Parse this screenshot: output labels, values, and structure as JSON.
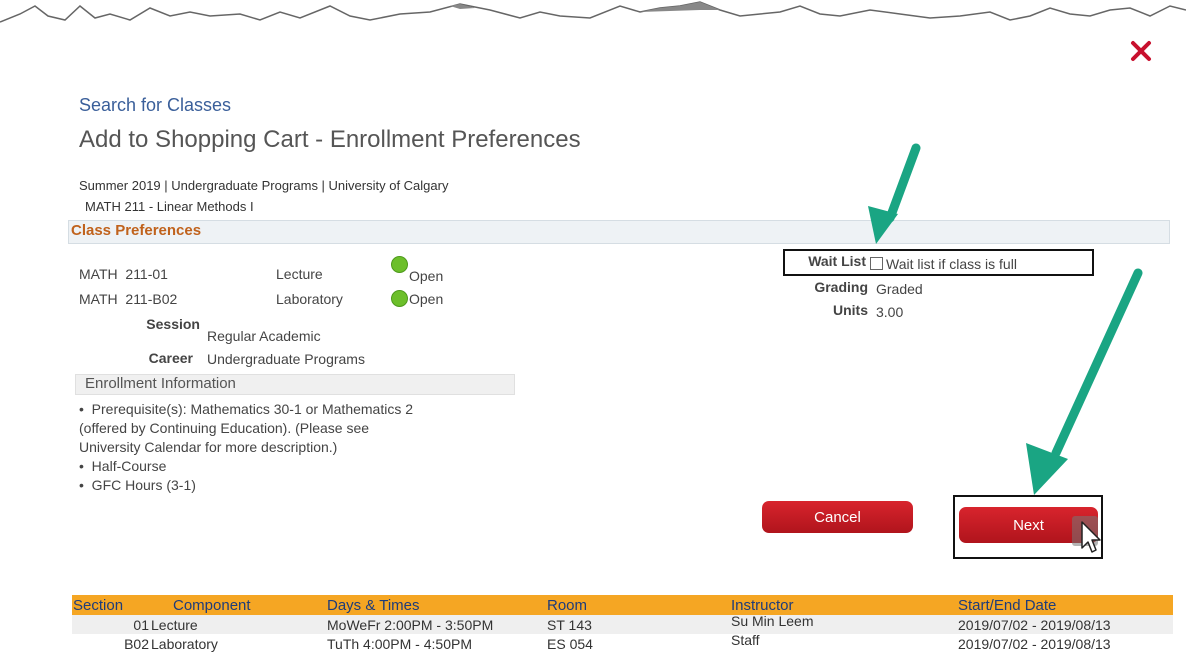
{
  "header": {
    "breadcrumb": "Search for Classes",
    "title": "Add to Shopping Cart - Enrollment Preferences"
  },
  "term_line": "Summer 2019 | Undergraduate Programs | University of Calgary",
  "course_line": "MATH  211 - Linear Methods I",
  "class_preferences": {
    "section_title": "Class Preferences",
    "classes": [
      {
        "code": "MATH  211-01",
        "component": "Lecture",
        "status": "Open"
      },
      {
        "code": "MATH  211-B02",
        "component": "Laboratory",
        "status": "Open"
      }
    ],
    "session_label": "Session",
    "session_value": "Regular Academic",
    "career_label": "Career",
    "career_value": "Undergraduate Programs",
    "wait_list_label": "Wait List",
    "wait_list_option": "Wait list if class is full",
    "grading_label": "Grading",
    "grading_value": "Graded",
    "units_label": "Units",
    "units_value": "3.00"
  },
  "enrollment_info": {
    "title": "Enrollment Information",
    "lines": [
      "•  Prerequisite(s): Mathematics 30-1 or Mathematics 2",
      "(offered by Continuing Education). (Please see",
      "University Calendar for more description.)",
      "•  Half-Course",
      "•  GFC Hours (3-1)"
    ]
  },
  "buttons": {
    "cancel": "Cancel",
    "next": "Next"
  },
  "table": {
    "headers": [
      "Section",
      "Component",
      "Days & Times",
      "Room",
      "Instructor",
      "Start/End Date"
    ],
    "rows": [
      [
        "01",
        "Lecture",
        "MoWeFr 2:00PM - 3:50PM",
        "ST 143",
        "Su Min Leem",
        "2019/07/02 - 2019/08/13"
      ],
      [
        "B02",
        "Laboratory",
        "TuTh 4:00PM - 4:50PM",
        "ES 054",
        "Staff",
        "2019/07/02 - 2019/08/13"
      ]
    ]
  },
  "colors": {
    "accent_red": "#c8102e",
    "annotation_arrow": "#1aa583",
    "table_header": "#f5a623",
    "status_open": "#6cbf2a"
  }
}
